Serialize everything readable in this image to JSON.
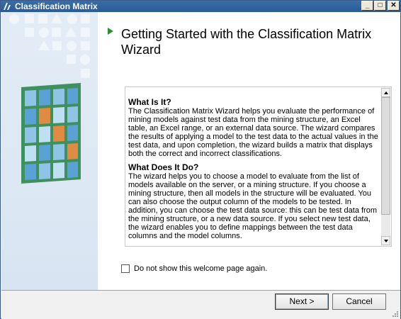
{
  "window": {
    "title": "Classification Matrix",
    "controls": {
      "minimize": "_",
      "maximize": "□",
      "close": "✕"
    }
  },
  "heading": "Getting Started with the Classification Matrix Wizard",
  "sections": [
    {
      "title": "What Is It?",
      "body": "The Classification Matrix Wizard helps you evaluate the performance of mining models against test data from the mining structure, an Excel table, an Excel range, or an external data source. The wizard compares the results of applying a model to the test data to the actual values in the test data, and upon completion, the wizard builds a matrix that displays both the correct and incorrect classifications."
    },
    {
      "title": "What Does It Do?",
      "body": "The wizard helps you to choose a model to evaluate from the list of models available on the server, or a mining structure. If you choose a mining structure, then all models in the structure will be evaluated. You can also choose the output column of the models to be tested. In addition, you can choose the test data source: this can be test data from the mining structure, or a new data source. If you select new test data, the wizard enables you to define mappings between the test data columns and the model columns."
    }
  ],
  "checkbox": {
    "label": "Do not show this welcome page again.",
    "checked": false
  },
  "buttons": {
    "next": "Next >",
    "cancel": "Cancel"
  },
  "icons": {
    "title_icon": "excel-datamining-icon",
    "heading_arrow": "green-arrow-icon",
    "matrix_art": "classification-matrix-grid-icon"
  },
  "colors": {
    "titlebar": "#2a5a9a",
    "accent_green": "#2f8f2f",
    "matrix_blue": "#5aa2d6",
    "matrix_orange": "#e08a44",
    "matrix_frame": "#3f8f5f"
  }
}
